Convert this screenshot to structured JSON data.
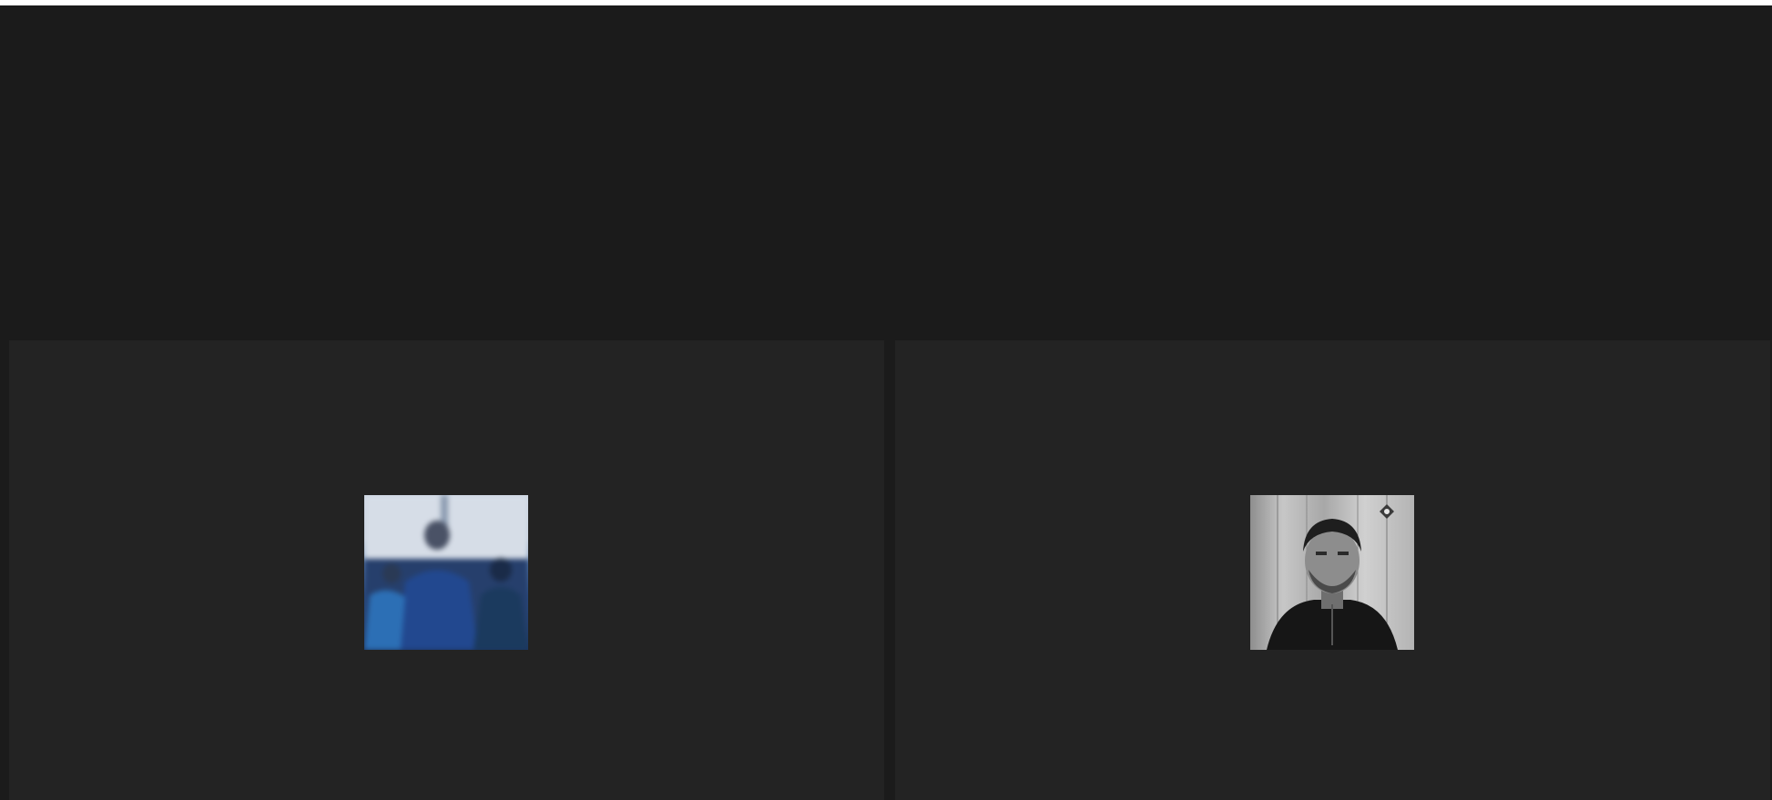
{
  "window": {
    "title": ""
  },
  "participants": [
    {
      "id": "participant-1",
      "avatar_style": "blurred-color",
      "accent": "#2c4f8a"
    },
    {
      "id": "participant-2",
      "avatar_style": "grayscale",
      "accent": "#1a1a1a"
    }
  ],
  "colors": {
    "background": "#1b1b1b",
    "tile": "#232323",
    "top_strip": "#ffffff"
  }
}
